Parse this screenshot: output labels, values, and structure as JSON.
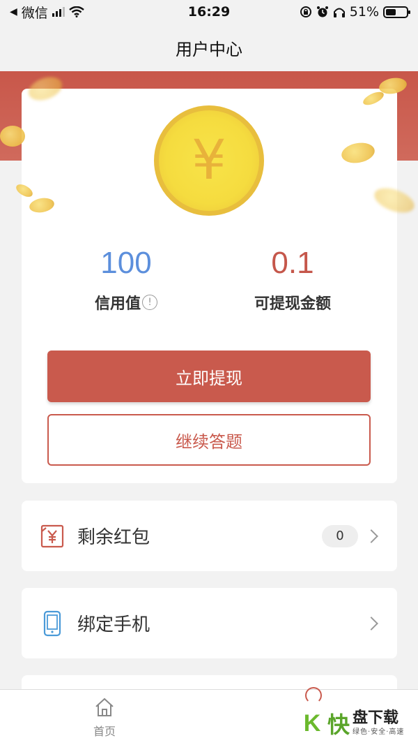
{
  "status_bar": {
    "back_app": "微信",
    "time": "16:29",
    "battery_text": "51%"
  },
  "nav": {
    "title": "用户中心"
  },
  "hero": {
    "coin_symbol": "¥"
  },
  "stats": {
    "credit_value": "100",
    "credit_label": "信用值",
    "info_glyph": "!",
    "cash_value": "0.1",
    "cash_label": "可提现金额"
  },
  "buttons": {
    "withdraw_label": "立即提现",
    "continue_label": "继续答题"
  },
  "list": {
    "red_packet_label": "剩余红包",
    "red_packet_count": "0",
    "bind_phone_label": "绑定手机"
  },
  "tabbar": {
    "home_label": "首页"
  },
  "watermark": {
    "logo_letter": "K",
    "logo_char": "快",
    "title": "盘下载",
    "subtitle": "绿色·安全·高速"
  },
  "colors": {
    "brand_red": "#c95a4d",
    "credit_blue": "#5c8fdc",
    "coin_gold": "#f5dc3f"
  },
  "icons": {
    "red_packet": "red-packet-yen-icon",
    "phone": "mobile-phone-icon",
    "home": "home-icon",
    "info": "info-circle-icon"
  }
}
